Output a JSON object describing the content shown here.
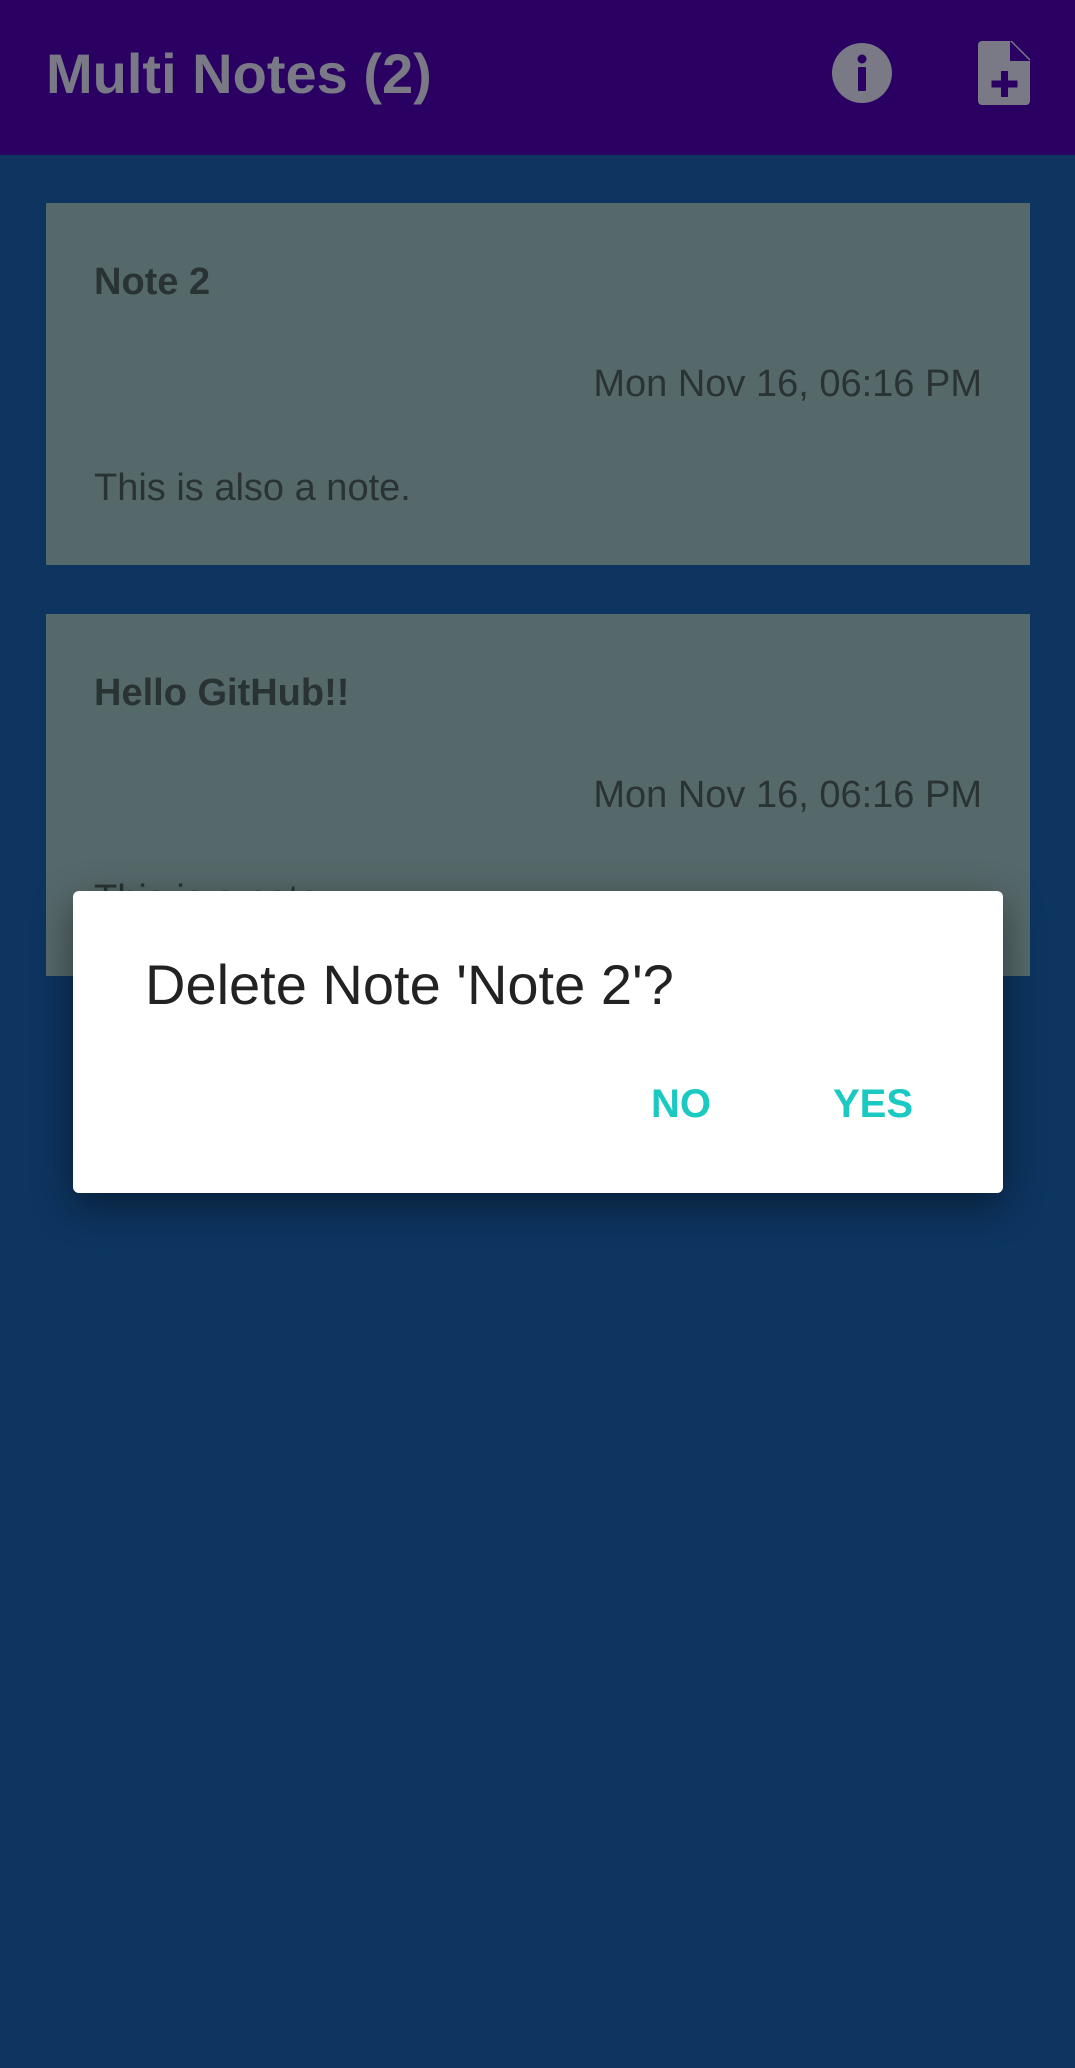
{
  "appbar": {
    "title": "Multi Notes (2)",
    "info_icon": "info-icon",
    "add_icon": "add-note-icon"
  },
  "notes": [
    {
      "title": "Note 2",
      "date": "Mon Nov 16, 06:16 PM",
      "body": "This is also a note."
    },
    {
      "title": "Hello GitHub!!",
      "date": "Mon Nov 16, 06:16 PM",
      "body": "This is a note."
    }
  ],
  "dialog": {
    "title": "Delete Note 'Note 2'?",
    "no_label": "NO",
    "yes_label": "YES"
  },
  "colors": {
    "appbar_bg": "#2a0063",
    "content_bg": "#0d3560",
    "card_bg": "#56696a",
    "accent": "#19c9c2"
  }
}
